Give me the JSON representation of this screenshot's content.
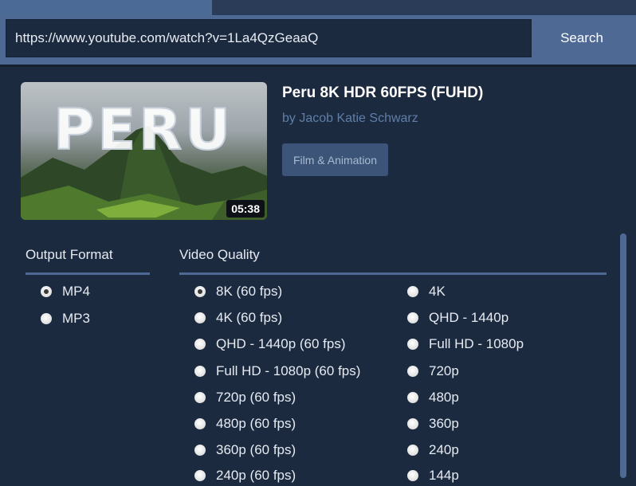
{
  "search": {
    "url_value": "https://www.youtube.com/watch?v=1La4QzGeaaQ",
    "button_label": "Search"
  },
  "video": {
    "thumbnail_text": "PERU",
    "duration": "05:38",
    "title": "Peru 8K HDR 60FPS (FUHD)",
    "author": "by Jacob Katie Schwarz",
    "category": "Film & Animation"
  },
  "output_format": {
    "title": "Output Format",
    "options": [
      "MP4",
      "MP3"
    ],
    "selected": "MP4"
  },
  "video_quality": {
    "title": "Video Quality",
    "left_options": [
      "8K (60 fps)",
      "4K (60 fps)",
      "QHD - 1440p (60 fps)",
      "Full HD - 1080p (60 fps)",
      "720p (60 fps)",
      "480p (60 fps)",
      "360p (60 fps)",
      "240p (60 fps)"
    ],
    "right_options": [
      "4K",
      "QHD - 1440p",
      "Full HD - 1080p",
      "720p",
      "480p",
      "360p",
      "240p",
      "144p"
    ],
    "selected": "8K (60 fps)"
  },
  "colors": {
    "background": "#1c2a40",
    "accent": "#4d6994",
    "author": "#5f7fa8"
  }
}
